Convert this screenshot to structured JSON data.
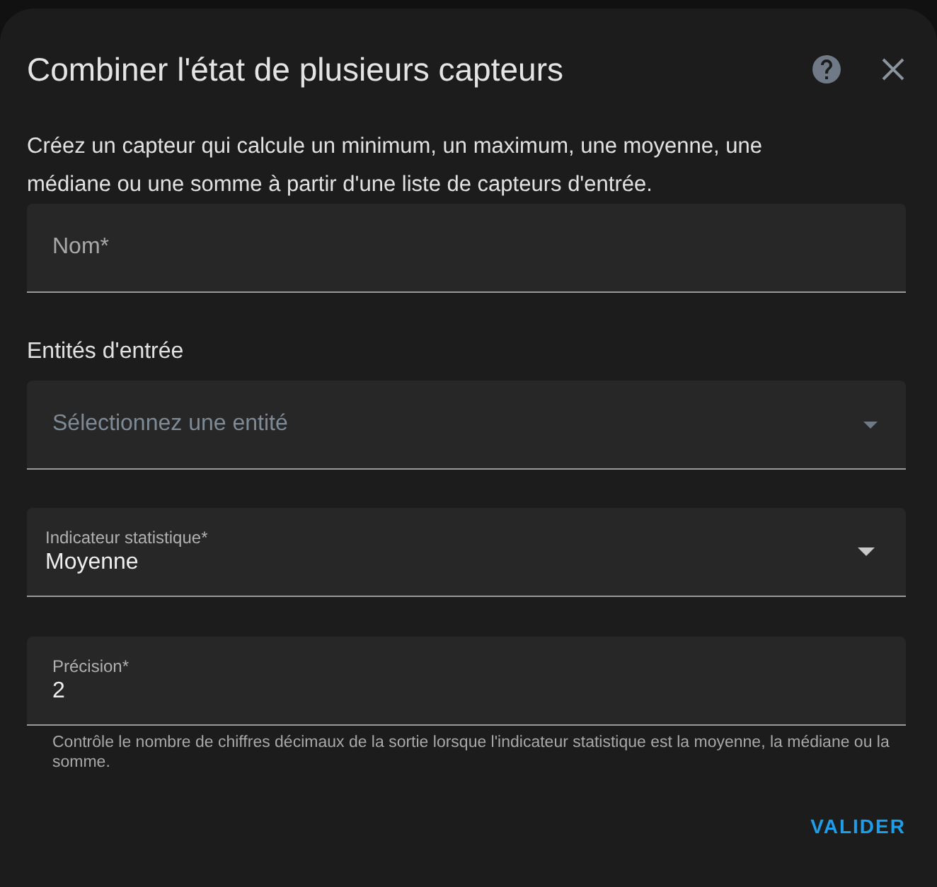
{
  "dialog": {
    "title": "Combiner l'état de plusieurs capteurs",
    "description": "Créez un capteur qui calcule un minimum, un maximum, une moyenne, une médiane ou une somme à partir d'une liste de capteurs d'entrée.",
    "fields": [
      {
        "kind": "text",
        "label": "Nom*"
      },
      {
        "kind": "picker",
        "section_label": "Entités d'entrée",
        "placeholder": "Sélectionnez une entité"
      },
      {
        "kind": "select",
        "label": "Indicateur statistique*",
        "value": "Moyenne"
      },
      {
        "kind": "number",
        "label": "Précision*",
        "value": "2",
        "helper": "Contrôle le nombre de chiffres décimaux de la sortie lorsque l'indicateur statistique est la moyenne, la médiane ou la somme."
      }
    ],
    "actions": [
      "VALIDER"
    ]
  }
}
